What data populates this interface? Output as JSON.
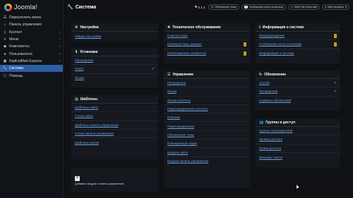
{
  "app": {
    "logo_text": "Joomla!"
  },
  "sidebar": {
    "items": [
      {
        "label": "Переключить меню",
        "icon": "toggle-icon",
        "chevron": ""
      },
      {
        "label": "Панель управления",
        "icon": "home-icon",
        "chevron": ""
      },
      {
        "label": "Контент",
        "icon": "file-icon",
        "chevron": "›"
      },
      {
        "label": "Меню",
        "icon": "list-icon",
        "chevron": "›"
      },
      {
        "label": "Компоненты",
        "icon": "cube-icon",
        "chevron": "›"
      },
      {
        "label": "Пользователи",
        "icon": "users-icon",
        "chevron": "›"
      },
      {
        "label": "RadicalMart Express",
        "icon": "cart-icon",
        "chevron": "›"
      },
      {
        "label": "Система",
        "icon": "wrench-icon",
        "chevron": ""
      },
      {
        "label": "Помощь",
        "icon": "info-icon",
        "chevron": ""
      }
    ],
    "active_index": 7
  },
  "header": {
    "title": "Система",
    "version": "5.1.3",
    "pills": [
      {
        "label": "Обновление темы",
        "count": ""
      },
      {
        "count": "2",
        "label": "Сообщения после установки"
      },
      {
        "label": "Web Folk Demo site",
        "count": ""
      },
      {
        "label": "Мой профиль",
        "count": ""
      }
    ]
  },
  "cards": {
    "settings": {
      "title": "Настройки",
      "links": [
        {
          "label": "Общие настройки"
        }
      ]
    },
    "install": {
      "title": "Установка",
      "links": [
        {
          "label": "Расширения"
        },
        {
          "label": "Поиск",
          "check": "✓"
        },
        {
          "label": "Языки"
        }
      ]
    },
    "templates": {
      "title": "Шаблоны",
      "links": [
        {
          "label": "Шаблоны сайта"
        },
        {
          "label": "Стили сайта"
        },
        {
          "label": "Шаблоны панели управления"
        },
        {
          "label": "Стили панели управления"
        },
        {
          "label": "Шаблоны писем"
        }
      ]
    },
    "maintenance": {
      "title": "Техническое обслуживание",
      "links": [
        {
          "label": "Очистка кэша"
        },
        {
          "label": "Проверка базы данных",
          "badge": "!"
        },
        {
          "label": "Разблокировка элементов",
          "badge": "!"
        }
      ]
    },
    "manage": {
      "title": "Управление",
      "links": [
        {
          "label": "Расширения"
        },
        {
          "label": "Языки"
        },
        {
          "label": "Языки контента"
        },
        {
          "label": "Переопределение констант"
        },
        {
          "label": "Плагины"
        },
        {
          "label": "Перенаправления"
        },
        {
          "label": "Обновление темы"
        },
        {
          "label": "Планировщик задач"
        },
        {
          "label": "Модули сайта"
        },
        {
          "label": "Модули панели управления"
        }
      ]
    },
    "info": {
      "title": "Информация о системе",
      "links": [
        {
          "label": "Предупреждения",
          "badge": "!"
        },
        {
          "label": "Сообщения после установки",
          "badge": "!"
        },
        {
          "label": "Информация о системе"
        }
      ]
    },
    "update": {
      "title": "Обновление",
      "links": [
        {
          "label": "Joomla",
          "check": "✓"
        },
        {
          "label": "Расширения",
          "check": "✓"
        },
        {
          "label": "Серверы обновлений"
        }
      ]
    },
    "access": {
      "title": "Группы и доступ",
      "links": [
        {
          "label": "Группы пользователей"
        },
        {
          "label": "Уровни доступа"
        },
        {
          "label": "Права доступа"
        },
        {
          "label": "Фильтры текста"
        }
      ]
    }
  },
  "add_module": {
    "plus": "+",
    "label": "Добавить модуль в панель управления"
  }
}
